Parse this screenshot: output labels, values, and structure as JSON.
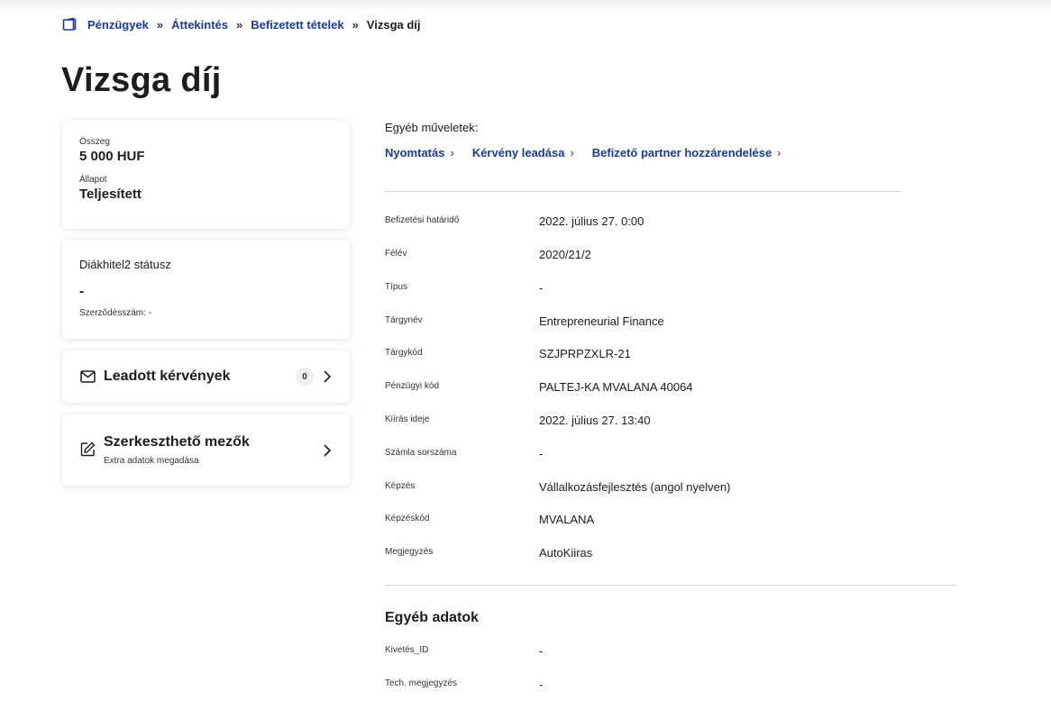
{
  "breadcrumb": {
    "items": [
      "Pénzügyek",
      "Áttekintés",
      "Befizetett tételek"
    ],
    "current": "Vizsga díj",
    "separator": "»"
  },
  "page": {
    "title": "Vizsga díj"
  },
  "amount_card": {
    "amount_label": "Összeg",
    "amount_value": "5 000 HUF",
    "status_label": "Állapot",
    "status_value": "Teljesített"
  },
  "loan_card": {
    "title": "Diákhitel2 státusz",
    "status_value": "-",
    "contract_number": "Szerződésszám: -"
  },
  "requests_card": {
    "label": "Leadott kérvények",
    "count": "0"
  },
  "editable_card": {
    "label": "Szerkeszthető mezők",
    "sub": "Extra adatok megadása"
  },
  "operations": {
    "label": "Egyéb műveletek:",
    "items": [
      "Nyomtatás",
      "Kérvény leadása",
      "Befizető partner hozzárendelése"
    ]
  },
  "details": [
    {
      "label": "Befizetési határidő",
      "value": "2022. július 27. 0:00"
    },
    {
      "label": "Félév",
      "value": "2020/21/2"
    },
    {
      "label": "Típus",
      "value": "-"
    },
    {
      "label": "Tárgynév",
      "value": "Entrepreneurial Finance"
    },
    {
      "label": "Tárgykód",
      "value": "SZJPRPZXLR-21"
    },
    {
      "label": "Pénzügyi kód",
      "value": "PALTEJ-KA MVALANA 40064"
    },
    {
      "label": "Kiírás ideje",
      "value": "2022. július 27. 13:40"
    },
    {
      "label": "Számla sorszáma",
      "value": "-"
    },
    {
      "label": "Képzés",
      "value": "Vállalkozásfejlesztés (angol nyelven)"
    },
    {
      "label": "Képzéskód",
      "value": "MVALANA"
    },
    {
      "label": "Megjegyzés",
      "value": "AutoKiiras"
    }
  ],
  "other_data": {
    "title": "Egyéb adatok",
    "rows": [
      {
        "label": "Kivetés_ID",
        "value": "-"
      },
      {
        "label": "Tech. megjegyzés",
        "value": "-"
      }
    ]
  },
  "colors": {
    "link": "#1b3a9b",
    "text": "#1d1d1f",
    "divider": "#d5d5d5"
  }
}
